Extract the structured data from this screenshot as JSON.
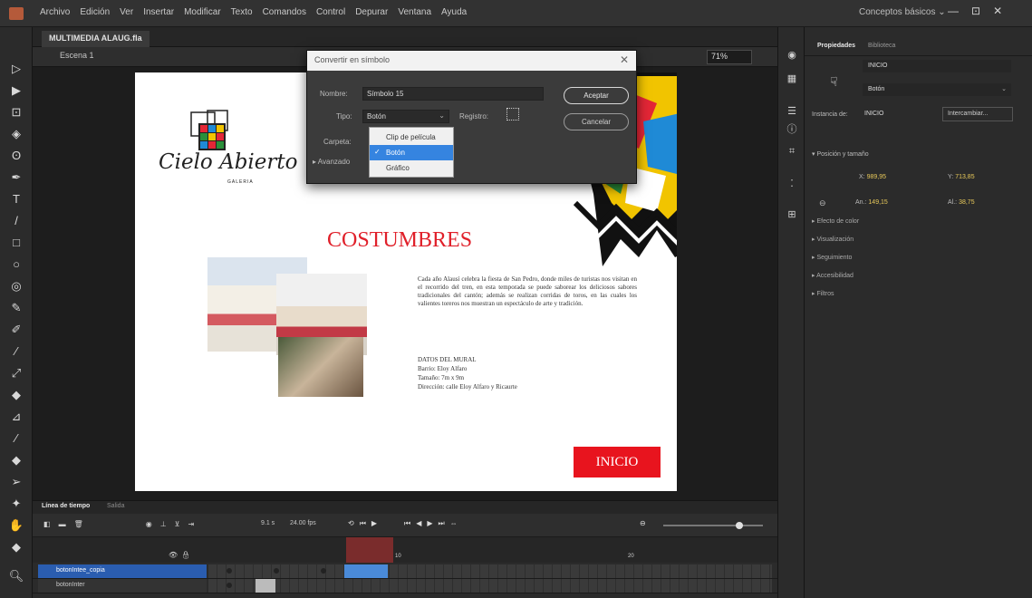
{
  "menubar": {
    "items": [
      "Archivo",
      "Edición",
      "Ver",
      "Insertar",
      "Modificar",
      "Texto",
      "Comandos",
      "Control",
      "Depurar",
      "Ventana",
      "Ayuda"
    ],
    "workspace": "Conceptos básicos ⌄",
    "window_controls": [
      "—",
      "⊡",
      "✕"
    ]
  },
  "document": {
    "tab_title": "MULTIMEDIA ALAUG.fla",
    "scene": "Escena 1",
    "zoom": "71%"
  },
  "stage": {
    "logo_text": "Cielo Abierto",
    "logo_subtitle": "GALERIA",
    "title": "COSTUMBRES",
    "description": "Cada año Alausí celebra la fiesta de San Pedro, donde miles de turistas nos visitan en el recorrido del tren, en esta temporada se puede saborear los deliciosos sabores tradicionales del cantón; además se realizan corridas de toros, en las cuales los valientes toreros nos muestran un espectáculo de arte y tradición.",
    "mural_info": [
      "DATOS DEL MURAL",
      "Barrio: Eloy Alfaro",
      "Tamaño: 7m x 9m",
      "Dirección: calle Eloy Alfaro y Ricaurte"
    ],
    "button_label": "INICIO"
  },
  "dialog": {
    "title": "Convertir en símbolo",
    "name_label": "Nombre:",
    "name_value": "Símbolo 15",
    "type_label": "Tipo:",
    "type_value": "Botón",
    "registration_label": "Registro:",
    "folder_label": "Carpeta:",
    "advanced_label": "▸ Avanzado",
    "accept": "Aceptar",
    "cancel": "Cancelar",
    "dropdown_options": [
      "Clip de película",
      "Botón",
      "Gráfico"
    ],
    "dropdown_selected_check": "✓"
  },
  "timeline": {
    "tab_label": "Línea de tiempo",
    "tab_output": "Salida",
    "fps": "24.00 fps",
    "frame": "9.1 s",
    "frame_number": "10",
    "frame_number2": "20",
    "layers": [
      "botonIntee_copia",
      "botonInter"
    ]
  },
  "properties": {
    "tab_properties": "Propiedades",
    "tab_library": "Biblioteca",
    "instance_name": "INICIO",
    "type": "Botón",
    "instance_of_label": "Instancia de:",
    "instance_of_value": "INICIO",
    "swap_button": "Intercambiar...",
    "position_section": "▾ Posición y tamaño",
    "x_label": "X:",
    "x_value": "989,95",
    "y_label": "Y:",
    "y_value": "713,85",
    "w_label": "An.:",
    "w_value": "149,15",
    "h_label": "Al.:",
    "h_value": "38,75",
    "link_icon": "⊖",
    "sections": [
      "▸ Efecto de color",
      "▸ Visualización",
      "▸ Seguimiento",
      "▸ Accesibilidad",
      "▸ Filtros"
    ]
  },
  "colors": {
    "accent_red": "#e0202a",
    "button_red": "#e8141e",
    "selection_blue": "#3584e0",
    "layer_blue": "#2a5db0",
    "playhead": "#7a2c2c"
  }
}
